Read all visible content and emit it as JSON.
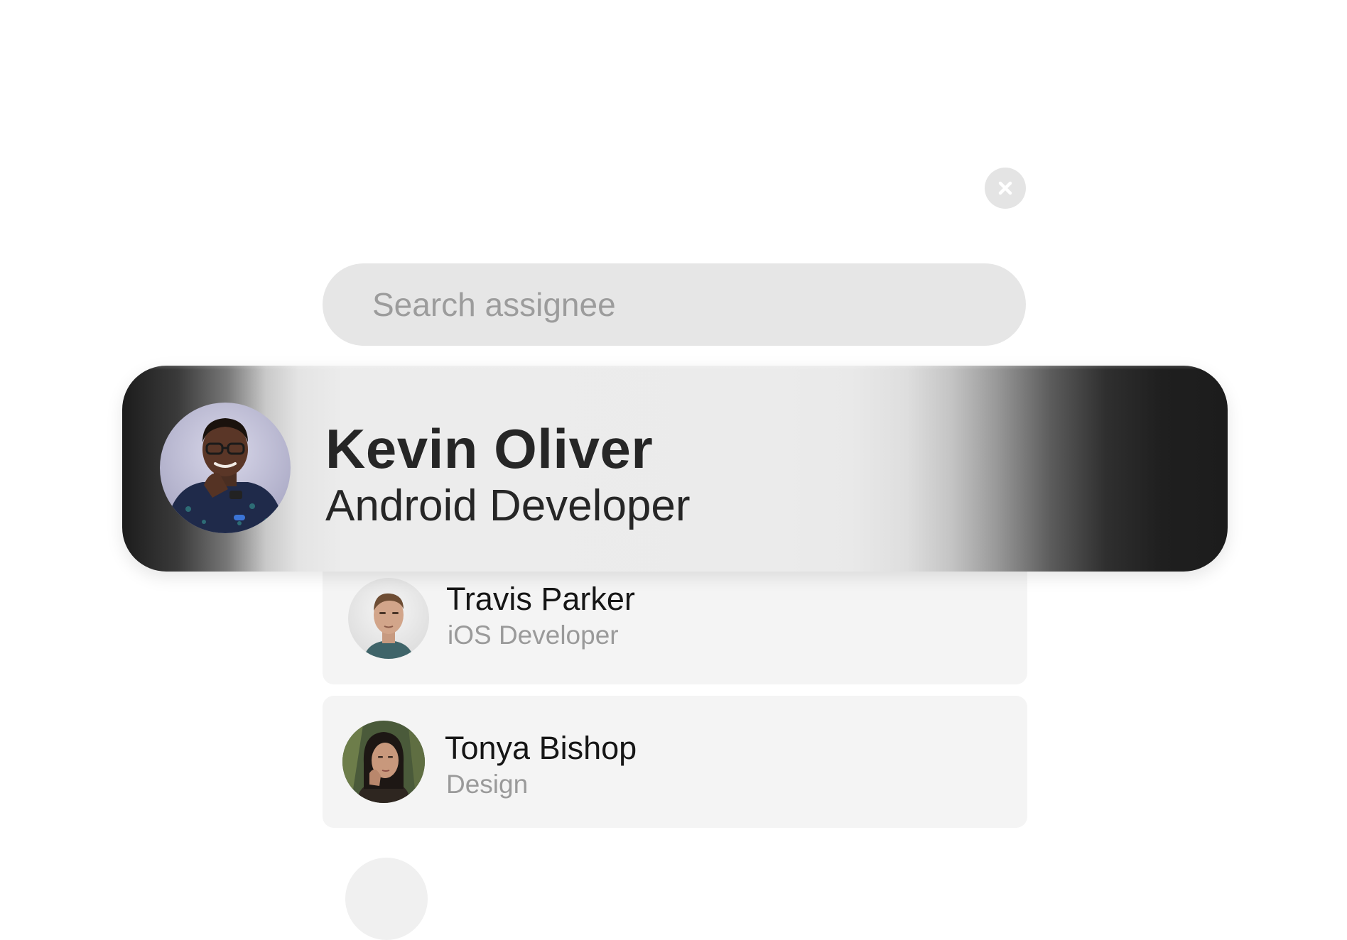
{
  "close_button": {
    "icon": "close-icon",
    "label": "Close"
  },
  "search": {
    "placeholder": "Search assignee",
    "value": ""
  },
  "highlighted_assignee": {
    "name": "Kevin Oliver",
    "role": "Android Developer",
    "avatar": "avatar-kevin-oliver"
  },
  "assignees": [
    {
      "name": "Travis Parker",
      "role": "iOS Developer",
      "avatar": "avatar-travis-parker"
    },
    {
      "name": "Tonya Bishop",
      "role": "Design",
      "avatar": "avatar-tonya-bishop"
    }
  ],
  "colors": {
    "card_bg": "#f4f4f4",
    "search_bg": "#e6e6e6",
    "highlight_edge": "#1c1c1c",
    "highlight_center": "#ebebeb",
    "secondary_text": "#9a9a9a"
  }
}
